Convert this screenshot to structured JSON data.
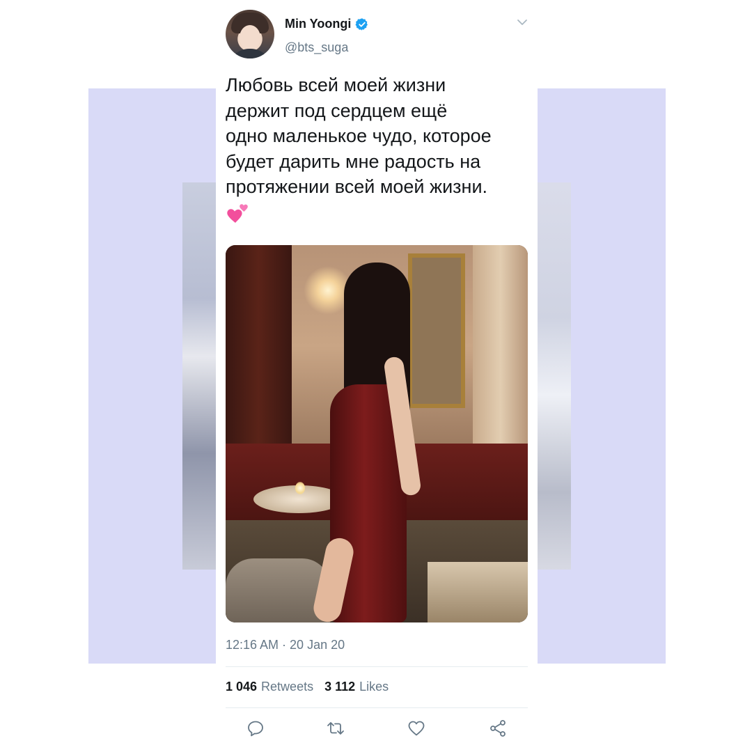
{
  "author": {
    "display_name": "Min Yoongi",
    "handle": "@bts_suga",
    "verified": true
  },
  "tweet": {
    "text": "Любовь всей моей жизни\nдержит под сердцем ещё\nодно маленькое чудо, которое\nбудет дарить мне радость на\nпротяжении всей моей жизни.",
    "emoji": "two-hearts",
    "media_icon": "photo"
  },
  "meta": {
    "timestamp": "12:16 AM · 20 Jan 20"
  },
  "stats": {
    "retweets_count": "1 046",
    "retweets_label": "Retweets",
    "likes_count": "3 112",
    "likes_label": "Likes"
  },
  "actions": [
    "reply-icon",
    "retweet-icon",
    "like-icon",
    "share-icon"
  ],
  "colors": {
    "text": "#14171a",
    "secondary": "#657786",
    "verified": "#1da1f2",
    "background_panels": "#d9daf7"
  }
}
